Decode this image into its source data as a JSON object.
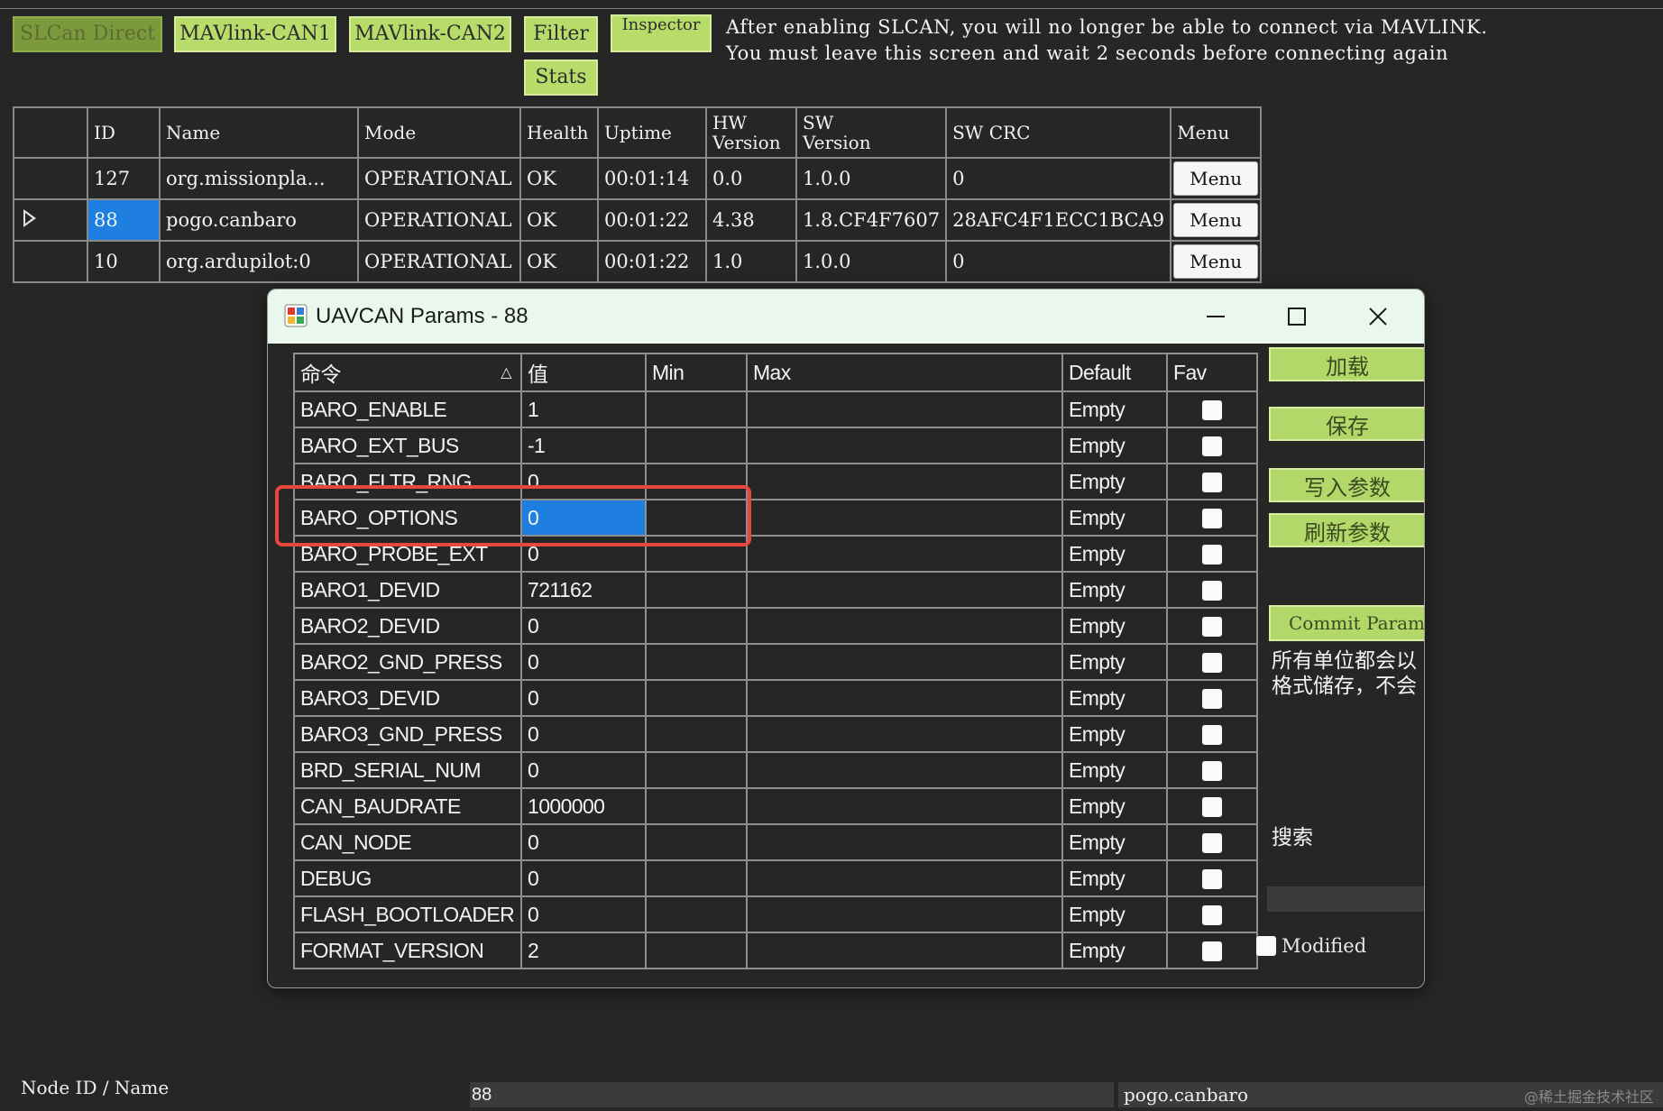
{
  "toolbar": {
    "slcan_direct": "SLCan Direct",
    "mavlink_can1": "MAVlink-CAN1",
    "mavlink_can2": "MAVlink-CAN2",
    "filter": "Filter",
    "inspector": "Inspector",
    "stats": "Stats"
  },
  "notice": "After enabling SLCAN, you will no longer be able to connect via MAVLINK.\nYou must leave this screen and wait 2 seconds before connecting again",
  "node_grid": {
    "headers": [
      "ID",
      "Name",
      "Mode",
      "Health",
      "Uptime",
      "HW\nVersion",
      "SW\nVersion",
      "SW CRC",
      "Menu"
    ],
    "rows": [
      {
        "id": "127",
        "name": "org.missionpla...",
        "mode": "OPERATIONAL",
        "health": "OK",
        "uptime": "00:01:14",
        "hw": "0.0",
        "sw": "1.0.0",
        "crc": "0",
        "menu": "Menu"
      },
      {
        "id": "88",
        "name": "pogo.canbaro",
        "mode": "OPERATIONAL",
        "health": "OK",
        "uptime": "00:01:22",
        "hw": "4.38",
        "sw": "1.8.CF4F7607",
        "crc": "28AFC4F1ECC1BCA9",
        "menu": "Menu"
      },
      {
        "id": "10",
        "name": "org.ardupilot:0",
        "mode": "OPERATIONAL",
        "health": "OK",
        "uptime": "00:01:22",
        "hw": "1.0",
        "sw": "1.0.0",
        "crc": "0",
        "menu": "Menu"
      }
    ]
  },
  "dialog": {
    "title": "UAVCAN Params - 88",
    "headers": {
      "command": "命令",
      "value": "值",
      "min": "Min",
      "max": "Max",
      "default": "Default",
      "fav": "Fav"
    },
    "params": [
      {
        "name": "BARO_ENABLE",
        "value": "1",
        "default": "Empty"
      },
      {
        "name": "BARO_EXT_BUS",
        "value": "-1",
        "default": "Empty"
      },
      {
        "name": "BARO_FLTR_RNG",
        "value": "0",
        "default": "Empty"
      },
      {
        "name": "BARO_OPTIONS",
        "value": "0",
        "default": "Empty"
      },
      {
        "name": "BARO_PROBE_EXT",
        "value": "0",
        "default": "Empty"
      },
      {
        "name": "BARO1_DEVID",
        "value": "721162",
        "default": "Empty"
      },
      {
        "name": "BARO2_DEVID",
        "value": "0",
        "default": "Empty"
      },
      {
        "name": "BARO2_GND_PRESS",
        "value": "0",
        "default": "Empty"
      },
      {
        "name": "BARO3_DEVID",
        "value": "0",
        "default": "Empty"
      },
      {
        "name": "BARO3_GND_PRESS",
        "value": "0",
        "default": "Empty"
      },
      {
        "name": "BRD_SERIAL_NUM",
        "value": "0",
        "default": "Empty"
      },
      {
        "name": "CAN_BAUDRATE",
        "value": "1000000",
        "default": "Empty"
      },
      {
        "name": "CAN_NODE",
        "value": "0",
        "default": "Empty"
      },
      {
        "name": "DEBUG",
        "value": "0",
        "default": "Empty"
      },
      {
        "name": "FLASH_BOOTLOADER",
        "value": "0",
        "default": "Empty"
      },
      {
        "name": "FORMAT_VERSION",
        "value": "2",
        "default": "Empty"
      }
    ],
    "side": {
      "load": "加载",
      "save": "保存",
      "write": "写入参数",
      "refresh": "刷新参数",
      "commit": "Commit Params",
      "note_line1": "所有单位都会以",
      "note_line2": "格式储存，不会",
      "search_label": "搜索",
      "modified": "Modified"
    }
  },
  "bottom": {
    "label": "Node ID / Name",
    "node_id": "88",
    "node_name": "pogo.canbaro",
    "watermark": "@稀土掘金技术社区"
  },
  "colors": {
    "accent_green": "#b8dc6a",
    "selection_blue": "#1e7fe0",
    "highlight_red": "#e8473c",
    "background": "#262626"
  }
}
